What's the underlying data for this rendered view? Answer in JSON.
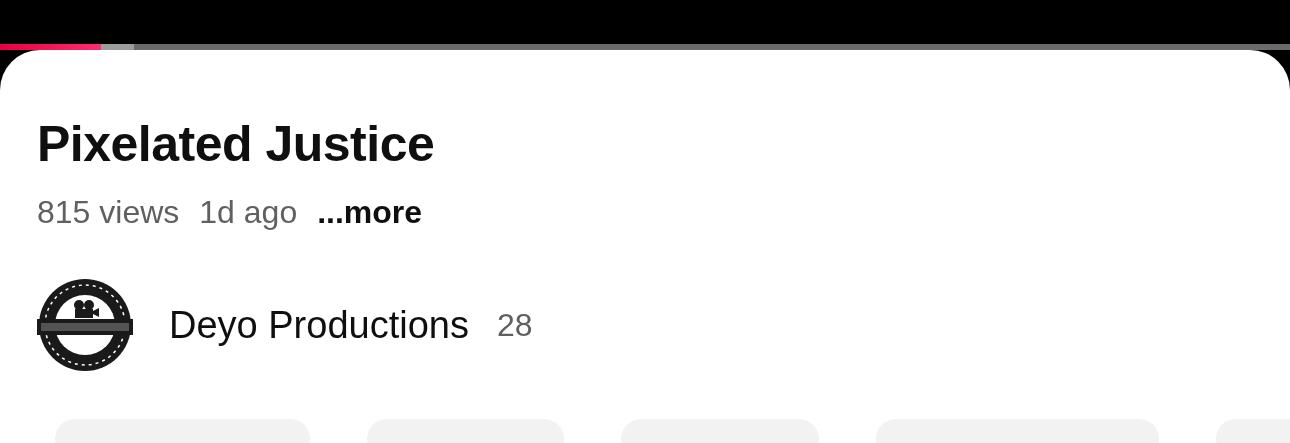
{
  "player": {
    "progress": {
      "level": 0.078
    }
  },
  "video": {
    "title": "Pixelated Justice",
    "views": "815 views",
    "age": "1d ago",
    "more": "...more"
  },
  "channel": {
    "name": "Deyo Productions",
    "subscribers": "28"
  },
  "chips": [
    {
      "kind": "blank"
    },
    {
      "kind": "blank"
    },
    {
      "kind": "blank"
    },
    {
      "kind": "blank"
    },
    {
      "kind": "blank"
    }
  ]
}
